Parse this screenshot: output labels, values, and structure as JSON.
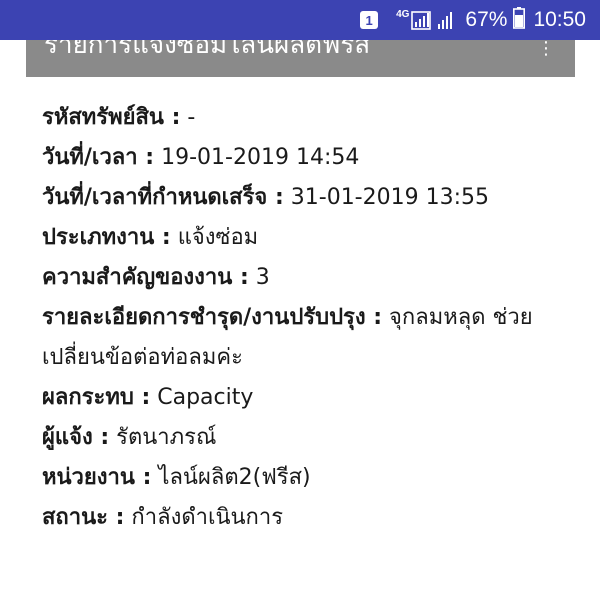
{
  "status_bar": {
    "notification_badge": "1",
    "network_type": "4G",
    "battery_percent": "67%",
    "time": "10:50"
  },
  "header": {
    "title": "รายการแจ้งซ่อมไลน์ผลิตฟรีส",
    "menu_icon": "more-vert-icon"
  },
  "details": [
    {
      "label": "รหัสทรัพย์สิน :",
      "value": " -"
    },
    {
      "label": "วันที่/เวลา :",
      "value": " 19-01-2019 14:54"
    },
    {
      "label": "วันที่/เวลาที่กำหนดเสร็จ :",
      "value": " 31-01-2019 13:55"
    },
    {
      "label": "ประเภทงาน :",
      "value": " แจ้งซ่อม"
    },
    {
      "label": "ความสำคัญของงาน :",
      "value": " 3"
    },
    {
      "label": "รายละเอียดการชำรุด/งานปรับปรุง :",
      "value": " จุกลมหลุด ช่วยเปลี่ยนข้อต่อท่อลมค่ะ"
    },
    {
      "label": "ผลกระทบ :",
      "value": " Capacity"
    },
    {
      "label": "ผู้แจ้ง :",
      "value": " รัตนาภรณ์"
    },
    {
      "label": "หน่วยงาน :",
      "value": " ไลน์ผลิต2(ฟรีส)"
    },
    {
      "label": "สถานะ :",
      "value": " กำลังดำเนินการ"
    }
  ]
}
